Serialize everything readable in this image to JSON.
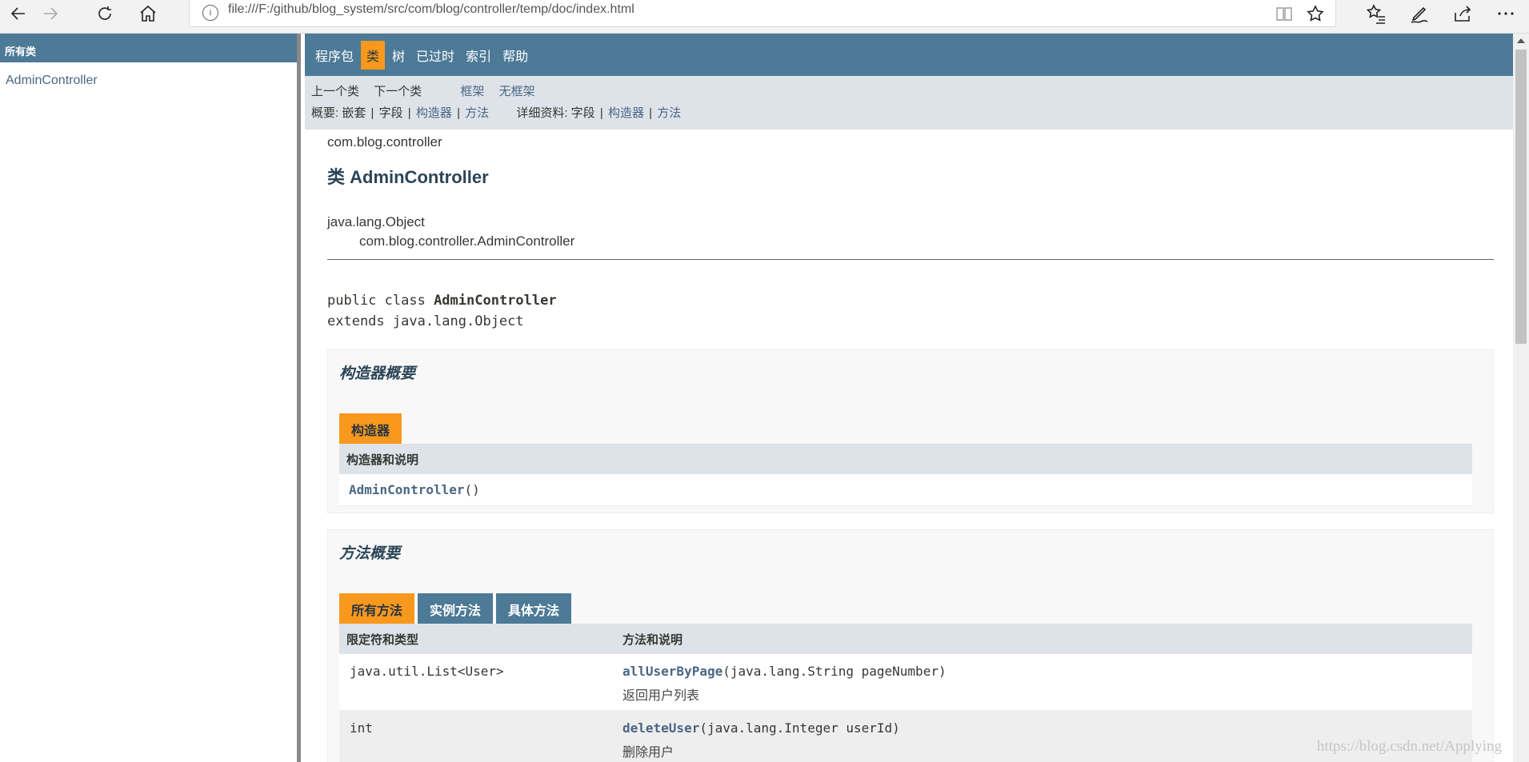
{
  "browser": {
    "url": "file:///F:/github/blog_system/src/com/blog/controller/temp/doc/index.html",
    "info_glyph": "i"
  },
  "left": {
    "header": "所有类",
    "classes": [
      "AdminController"
    ]
  },
  "topnav": {
    "items": [
      "程序包",
      "类",
      "树",
      "已过时",
      "索引",
      "帮助"
    ],
    "active_index": 1
  },
  "subnav": {
    "prev": "上一个类",
    "next": "下一个类",
    "frames": "框架",
    "no_frames": "无框架",
    "summary_label": "概要:",
    "summary_nested": "嵌套",
    "summary_field": "字段",
    "summary_constr": "构造器",
    "summary_method": "方法",
    "detail_label": "详细资料:",
    "detail_field": "字段",
    "detail_constr": "构造器",
    "detail_method": "方法",
    "pipe": "|"
  },
  "doc": {
    "package": "com.blog.controller",
    "title": "类 AdminController",
    "inherit_root": "java.lang.Object",
    "inherit_child": "com.blog.controller.AdminController",
    "sig_prefix": "public class ",
    "sig_name": "AdminController",
    "sig_extends": "extends java.lang.Object"
  },
  "constructor_summary": {
    "heading": "构造器概要",
    "tab": "构造器",
    "column": "构造器和说明",
    "rows": [
      {
        "name": "AdminController",
        "params": "()"
      }
    ]
  },
  "method_summary": {
    "heading": "方法概要",
    "tabs": [
      "所有方法",
      "实例方法",
      "具体方法"
    ],
    "columns": [
      "限定符和类型",
      "方法和说明"
    ],
    "rows": [
      {
        "type": "java.util.List<User>",
        "name": "allUserByPage",
        "params": "(java.lang.String pageNumber)",
        "desc": "返回用户列表"
      },
      {
        "type": "int",
        "name": "deleteUser",
        "params": "(java.lang.Integer userId)",
        "desc": "删除用户"
      }
    ]
  },
  "watermark": "https://blog.csdn.net/Applying",
  "colors": {
    "nav_bg": "#4d7a97",
    "active_tab": "#f8981d",
    "subnav_bg": "#dee3e9",
    "link": "#4a6782"
  }
}
